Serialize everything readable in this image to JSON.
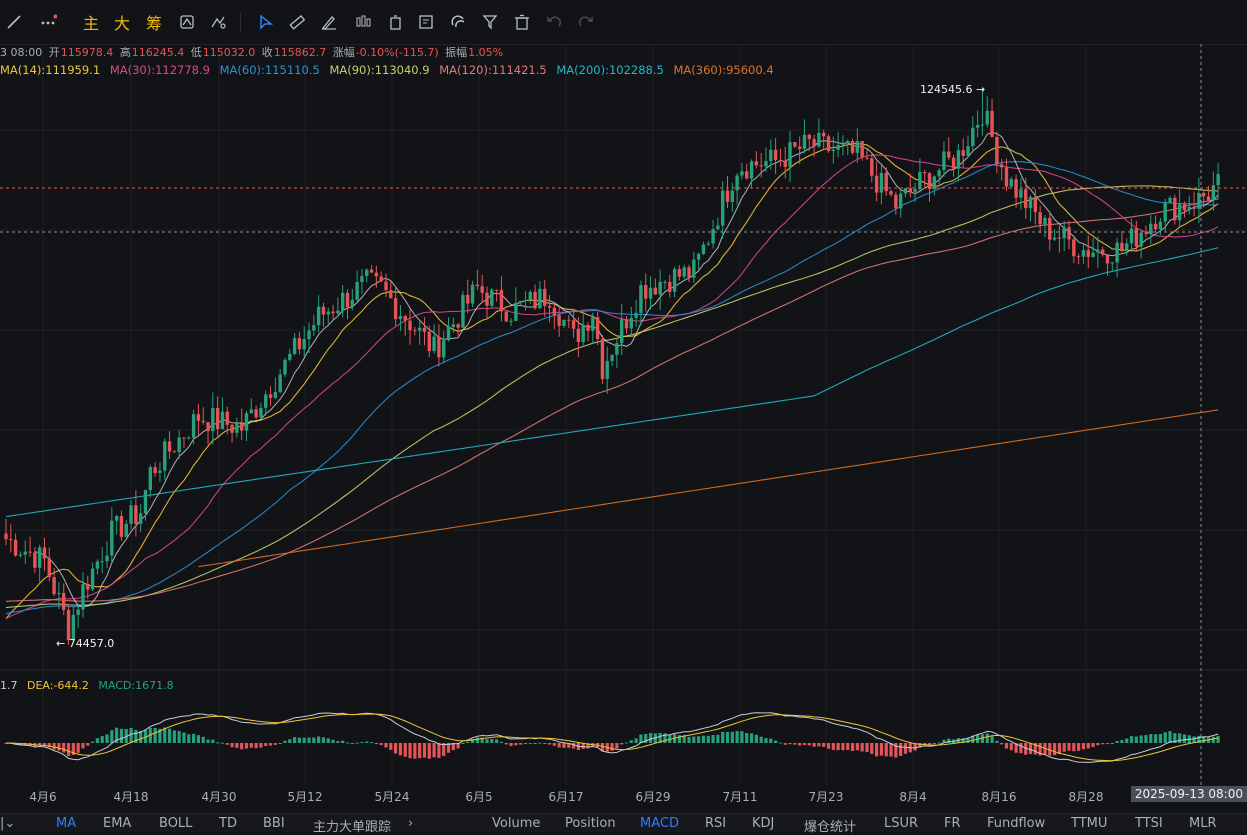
{
  "toolbar": {
    "labels": [
      "主",
      "大",
      "筹"
    ],
    "colors": {
      "accent": "#f0b90b",
      "active": "#2d7ff9"
    }
  },
  "info": {
    "date": "3 08:00",
    "open_label": "开",
    "open": "115978.4",
    "high_label": "高",
    "high": "116245.4",
    "low_label": "低",
    "low": "115032.0",
    "close_label": "收",
    "close": "115862.7",
    "change_label": "涨幅",
    "change": "-0.10%(-115.7)",
    "amp_label": "振幅",
    "amp": "1.05%"
  },
  "ma": [
    {
      "text": "MA(14):111959.1",
      "color": "#f0c43a"
    },
    {
      "text": "MA(30):112778.9",
      "color": "#d9478f"
    },
    {
      "text": "MA(60):115110.5",
      "color": "#2f8fd6"
    },
    {
      "text": "MA(90):113040.9",
      "color": "#c7cf6a"
    },
    {
      "text": "MA(120):111421.5",
      "color": "#e07a7a"
    },
    {
      "text": "MA(200):102288.5",
      "color": "#23b8c8"
    },
    {
      "text": "MA(360):95600.4",
      "color": "#e07224"
    }
  ],
  "macd_info": {
    "dif": "1.7",
    "dea": "DEA:-644.2",
    "macd": "MACD:1671.8"
  },
  "annotations": {
    "high": "124545.6",
    "low": "74457.0"
  },
  "chart_data": {
    "type": "candlestick",
    "x_ticks": [
      "4月6",
      "4月18",
      "4月30",
      "5月12",
      "5月24",
      "6月5",
      "6月17",
      "6月29",
      "7月11",
      "7月23",
      "8月4",
      "8月16",
      "8月28"
    ],
    "cursor_label": "2025-09-13 08:00",
    "high": 124545.6,
    "low": 74457.0,
    "price_path": [
      [
        0,
        84000
      ],
      [
        8,
        82000
      ],
      [
        13,
        76000
      ],
      [
        16,
        79500
      ],
      [
        22,
        84500
      ],
      [
        28,
        86500
      ],
      [
        30,
        90000
      ],
      [
        40,
        95000
      ],
      [
        49,
        94000
      ],
      [
        53,
        96500
      ],
      [
        65,
        104000
      ],
      [
        75,
        107000
      ],
      [
        78,
        106500
      ],
      [
        83,
        104000
      ],
      [
        89,
        101000
      ],
      [
        98,
        106500
      ],
      [
        105,
        104500
      ],
      [
        113,
        106000
      ],
      [
        118,
        102000
      ],
      [
        122,
        104500
      ],
      [
        124,
        99500
      ],
      [
        132,
        106500
      ],
      [
        138,
        107500
      ],
      [
        143,
        108000
      ],
      [
        152,
        117500
      ],
      [
        160,
        118000
      ],
      [
        167,
        119500
      ],
      [
        177,
        118500
      ],
      [
        185,
        114000
      ],
      [
        190,
        116000
      ],
      [
        198,
        118500
      ],
      [
        203,
        122500
      ],
      [
        208,
        116500
      ],
      [
        216,
        112000
      ],
      [
        224,
        110000
      ],
      [
        232,
        110000
      ],
      [
        240,
        113500
      ],
      [
        248,
        114500
      ],
      [
        252,
        115800
      ]
    ],
    "series": [
      {
        "name": "MA(14)",
        "color": "#f0c43a",
        "last": 111959.1
      },
      {
        "name": "MA(30)",
        "color": "#d9478f",
        "last": 112778.9
      },
      {
        "name": "MA(60)",
        "color": "#2f8fd6",
        "last": 115110.5
      },
      {
        "name": "MA(90)",
        "color": "#c7cf6a",
        "last": 113040.9
      },
      {
        "name": "MA(120)",
        "color": "#e07a7a",
        "last": 111421.5
      },
      {
        "name": "MA(200)",
        "color": "#23b8c8",
        "last": 102288.5
      },
      {
        "name": "MA(360)",
        "color": "#e07224",
        "last": 95600.4
      }
    ],
    "up_color": "#26a17b",
    "down_color": "#e55458",
    "grid": true
  },
  "indicators": {
    "left": [
      "MA",
      "EMA",
      "BOLL",
      "TD",
      "BBI",
      "主力大单跟踪"
    ],
    "right": [
      "Volume",
      "Position",
      "MACD",
      "RSI",
      "KDJ",
      "爆仓统计",
      "LSUR",
      "FR",
      "Fundflow",
      "TTMU",
      "TTSI",
      "MLR"
    ],
    "active_left": "MA",
    "active_right": "MACD"
  }
}
